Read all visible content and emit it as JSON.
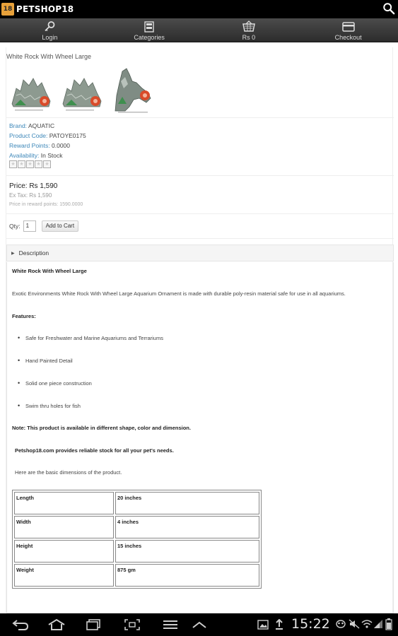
{
  "app": {
    "title": "PETSHOP18",
    "logo_text": "18"
  },
  "nav": {
    "tabs": [
      {
        "label": "Login",
        "icon": "key-icon"
      },
      {
        "label": "Categories",
        "icon": "list-icon"
      },
      {
        "label": "Rs 0",
        "icon": "cart-icon"
      },
      {
        "label": "Checkout",
        "icon": "credit-card-icon"
      }
    ]
  },
  "product": {
    "title": "White Rock With Wheel Large",
    "brand_key": "Brand:",
    "brand_val": "AQUATIC",
    "code_key": "Product Code:",
    "code_val": "PATOYE0175",
    "reward_key": "Reward Points:",
    "reward_val": "0.0000",
    "avail_key": "Availability:",
    "avail_val": "In Stock",
    "price": "Price: Rs 1,590",
    "ex_tax": "Ex Tax: Rs 1,590",
    "reward_price": "Price in reward points: 1590.0000",
    "qty_label": "Qty:",
    "qty_value": "1",
    "add_to_cart": "Add to Cart"
  },
  "description": {
    "header": "Description",
    "heading": "White Rock With Wheel Large",
    "intro": "Exotic Environments White Rock With Wheel Large Aquarium Ornament is made with durable poly-resin material safe for use in all aquariums.",
    "features_label": "Features:",
    "features": [
      "Safe for Freshwater and Marine Aquariums and Terrariums",
      "Hand Painted Detail",
      "Solid one piece construction",
      "Swim thru holes for fish"
    ],
    "note": "Note: This product is available in different shape, color and dimension.",
    "stock": "Petshop18.com provides reliable stock for all your pet's needs.",
    "dims_intro": "Here are the basic dimensions of the product.",
    "dimensions": [
      {
        "label": "Length",
        "value": "20 inches"
      },
      {
        "label": "Width",
        "value": "4  inches"
      },
      {
        "label": "Height",
        "value": "15  inches"
      },
      {
        "label": "Weight",
        "value": "875 gm"
      }
    ]
  },
  "system": {
    "time": "15:22"
  },
  "colors": {
    "link": "#3b86b8",
    "bar": "#000000",
    "logo": "#e8a13a"
  }
}
